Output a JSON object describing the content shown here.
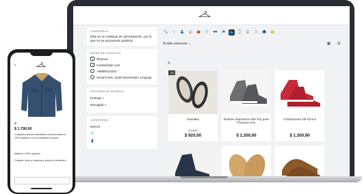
{
  "store": {
    "about_heading": "CONÓCENOS",
    "about_text": "Este es un catálogo de demostración, por lo que no se procesarán pedidos.",
    "contact_heading": "ENTRA EN CONTACTO",
    "contact": [
      {
        "icon": "instagram-icon",
        "text": "@tymus"
      },
      {
        "icon": "mail-icon",
        "text": "modas@tyte.com"
      },
      {
        "icon": "whatsapp-icon",
        "text": "+59899104310"
      },
      {
        "icon": "location-icon",
        "text": "Soriano 616, 11100 Montevideo, Uruguay"
      }
    ],
    "delivery_heading": "OPCIONES DE ENTREGA",
    "delivery": [
      {
        "label": "Entrega",
        "arrow": ">"
      },
      {
        "label": "Recogida",
        "arrow": ">"
      }
    ],
    "categories_heading": "CATEGORÍAS",
    "categories_first": "INICIO",
    "sort_label": "Más relevante",
    "products": [
      {
        "name": "Sandalia",
        "old_price": "$ 1.600",
        "price": "$ 920,00",
        "badge": "-34"
      },
      {
        "name": "Botines deportivos Mid-Top para l'homme Gris",
        "old_price": "",
        "price": "$ 1.200,00",
        "badge": ""
      },
      {
        "name": "Championes old school",
        "old_price": "",
        "price": "$ 1.200,00",
        "badge": ""
      }
    ]
  },
  "phone": {
    "price": "$ 1.790,00",
    "p1": "Chaqueta vaquera estrellada confeccionada en 100% algodón con un acabado premium.",
    "p2": "Material: 100% algodón",
    "p3": "Cuidado: lavar a máquina y secar en tendedero."
  },
  "colors": {
    "accent": "#2f3a4a",
    "badge": "#444444",
    "screen_bg": "#f1f2f4"
  }
}
